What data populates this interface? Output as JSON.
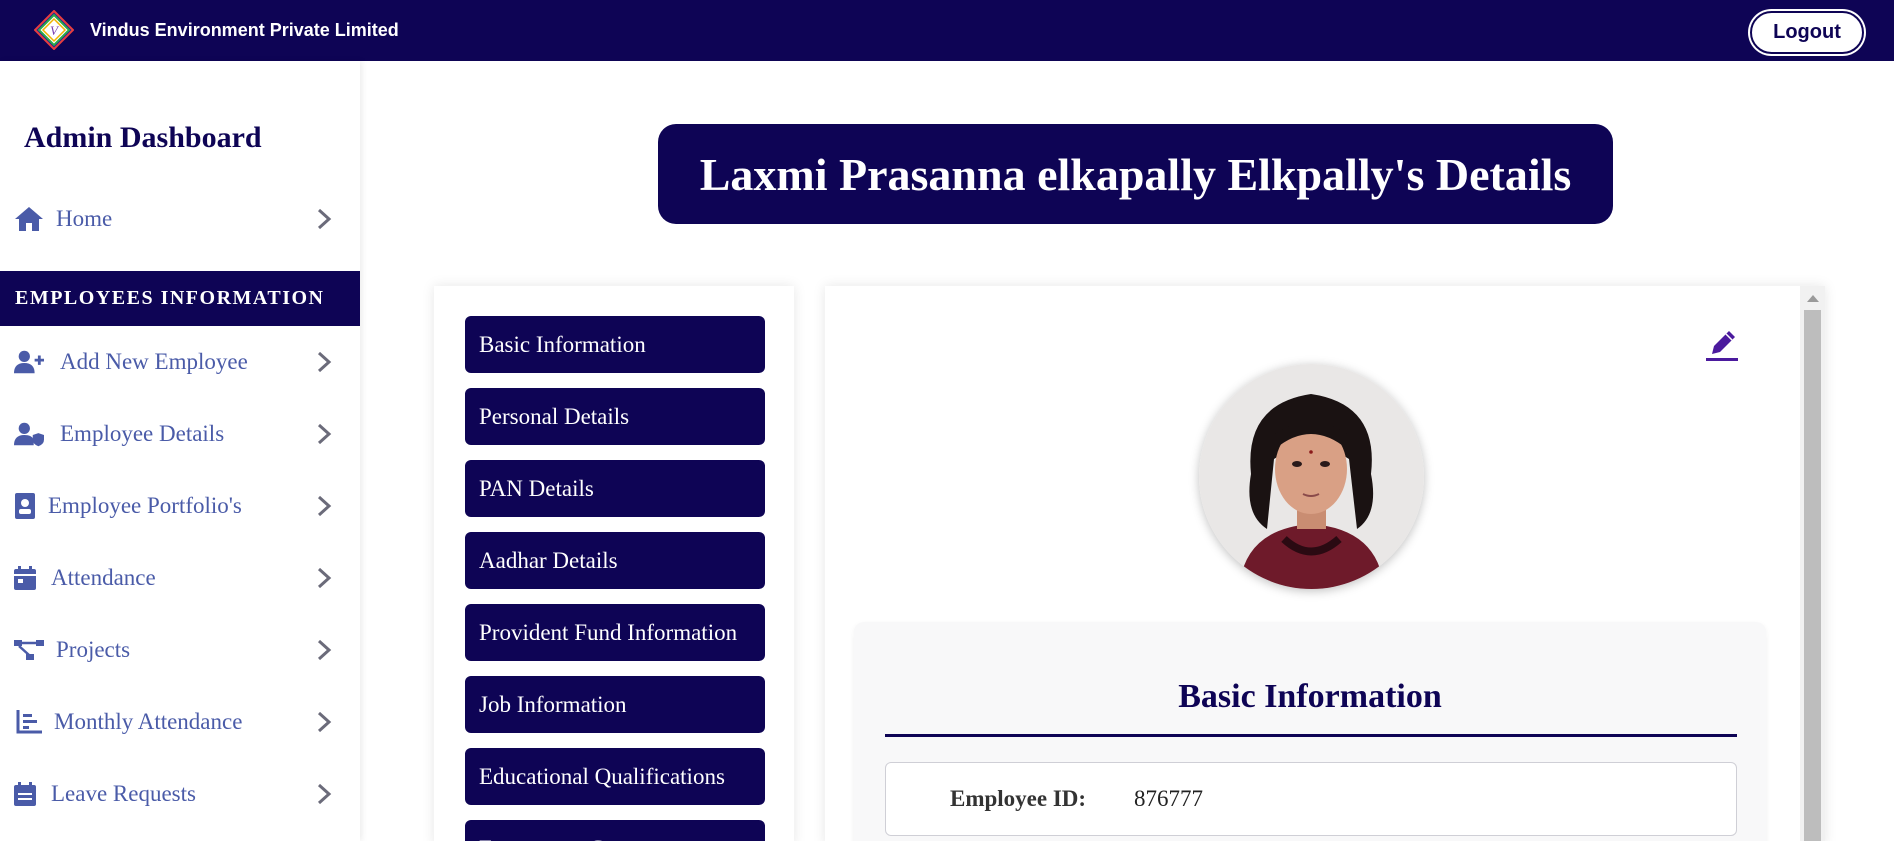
{
  "header": {
    "brand": "Vindus Environment Private Limited",
    "logout_label": "Logout",
    "logo_letter": "V"
  },
  "sidebar": {
    "title": "Admin Dashboard",
    "home_label": "Home",
    "section_label": "EMPLOYEES INFORMATION",
    "items": [
      {
        "label": "Add New Employee",
        "icon": "user-plus-icon"
      },
      {
        "label": "Employee Details",
        "icon": "user-shield-icon"
      },
      {
        "label": "Employee Portfolio's",
        "icon": "id-badge-icon"
      },
      {
        "label": "Attendance",
        "icon": "calendar-icon"
      },
      {
        "label": "Projects",
        "icon": "project-diagram-icon"
      },
      {
        "label": "Monthly Attendance",
        "icon": "bar-chart-icon"
      },
      {
        "label": "Leave Requests",
        "icon": "calendar-list-icon"
      }
    ]
  },
  "page": {
    "title": "Laxmi Prasanna elkapally Elkpally's Details"
  },
  "menu": {
    "items": [
      "Basic Information",
      "Personal Details",
      "PAN Details",
      "Aadhar Details",
      "Provident Fund Information",
      "Job Information",
      "Educational Qualifications",
      "Emergency Contacts"
    ]
  },
  "detail": {
    "section_title": "Basic Information",
    "fields": [
      {
        "label": "Employee ID:",
        "value": "876777"
      }
    ]
  },
  "colors": {
    "primary": "#0e0455",
    "nav_text": "#4a5ba8",
    "white": "#ffffff"
  }
}
